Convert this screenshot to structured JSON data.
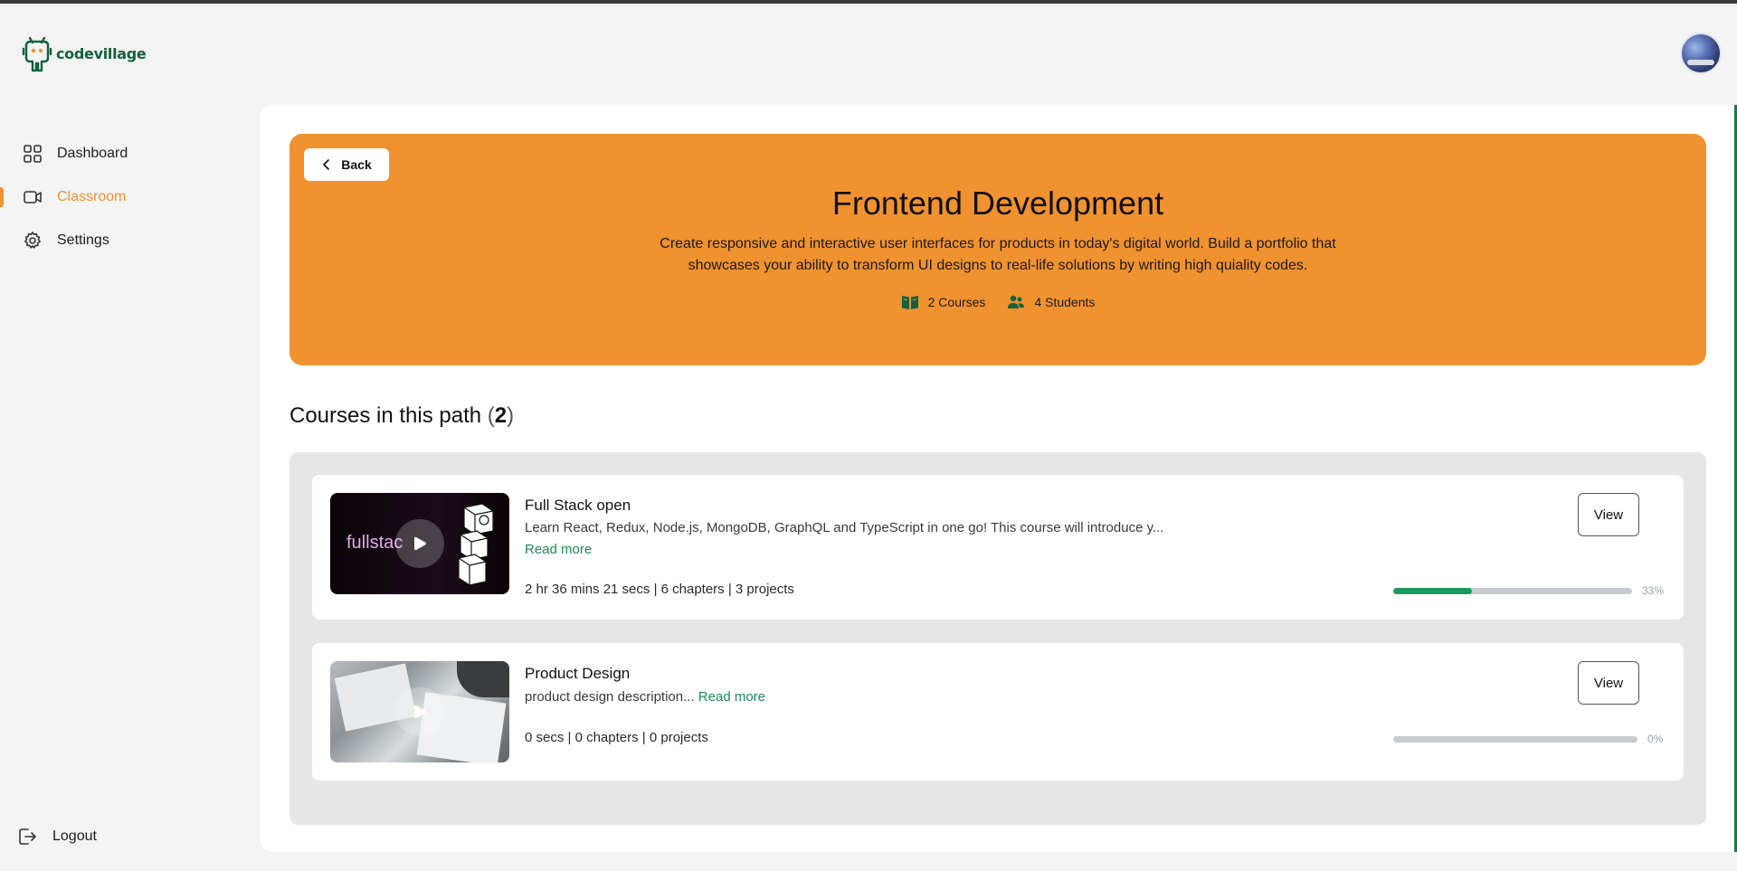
{
  "brand": {
    "name": "codevillage",
    "color": "#14613f"
  },
  "colors": {
    "accent": "#f0922f",
    "progress": "#1a9a5e",
    "link": "#1a8a58"
  },
  "sidebar": {
    "items": [
      {
        "label": "Dashboard",
        "icon": "grid-icon",
        "active": false
      },
      {
        "label": "Classroom",
        "icon": "video-icon",
        "active": true
      },
      {
        "label": "Settings",
        "icon": "gear-icon",
        "active": false
      }
    ],
    "logout_label": "Logout"
  },
  "hero": {
    "back_label": "Back",
    "title": "Frontend Development",
    "description": "Create responsive and interactive user interfaces for products in today's digital world. Build a portfolio that showcases your ability to transform UI designs to real-life solutions by writing high quiality codes.",
    "courses_stat": "2 Courses",
    "students_stat": "4 Students"
  },
  "section": {
    "title": "Courses in this path",
    "count_open": "(",
    "count": "2",
    "count_close": ")"
  },
  "courses": [
    {
      "title": "Full Stack open",
      "description": "Learn React, Redux, Node.js, MongoDB, GraphQL and TypeScript in one go! This course will introduce y...",
      "read_more": "Read more",
      "meta": "2 hr 36 mins 21 secs | 6 chapters | 3 projects",
      "view_label": "View",
      "progress": 0.33,
      "progress_label": "33%",
      "thumb_text": "fullstac"
    },
    {
      "title": "Product Design",
      "description": "product design description...",
      "read_more": "Read more",
      "meta": "0 secs | 0 chapters | 0 projects",
      "view_label": "View",
      "progress": 0,
      "progress_label": "0%"
    }
  ]
}
